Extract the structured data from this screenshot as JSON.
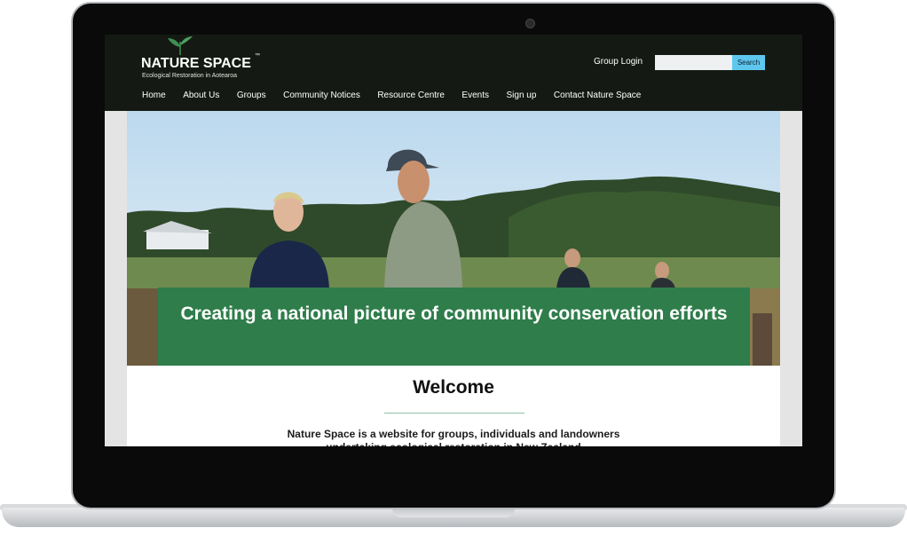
{
  "logo": {
    "title": "NATURE SPACE",
    "trademark": "™",
    "tagline": "Ecological Restoration in Aotearoa",
    "icon": "leaf-icon"
  },
  "header": {
    "group_login": "Group Login",
    "search_placeholder": "",
    "search_button": "Search"
  },
  "nav": {
    "items": [
      "Home",
      "About Us",
      "Groups",
      "Community Notices",
      "Resource Centre",
      "Events",
      "Sign up",
      "Contact Nature Space"
    ]
  },
  "hero": {
    "title": "Creating a national picture of community conservation efforts"
  },
  "welcome": {
    "heading": "Welcome",
    "intro": "Nature Space is a website for groups, individuals and landowners undertaking ecological restoration in New Zealand"
  },
  "colors": {
    "header_bg": "#141a13",
    "banner_green": "#2e7d4a",
    "search_blue": "#5ec7ed"
  }
}
